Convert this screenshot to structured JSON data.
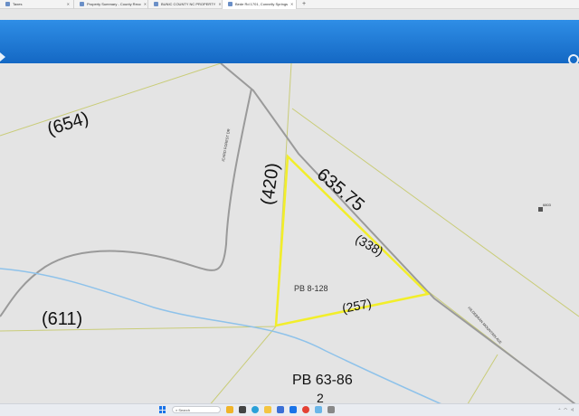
{
  "browser": {
    "tabs": [
      {
        "label": "Taxes",
        "active": false
      },
      {
        "label": "Property Summary - County Recc",
        "active": false
      },
      {
        "label": "BUNIC COUNTY NC PROPERTY",
        "active": false
      },
      {
        "label": "Bede Rd 1701, Connelly Springs",
        "active": true
      }
    ],
    "new_tab": "+"
  },
  "map": {
    "labels": {
      "parcel_654": "(654)",
      "parcel_420": "(420)",
      "parcel_611": "(611)",
      "road_635": "635.75",
      "seg_338": "(338)",
      "seg_257": "(257)",
      "pb_small": "PB 8-128",
      "pb_big": "PB 63-86",
      "lot_2": "2",
      "road_forest": "ICARD FOREST DR",
      "road_hildebrand": "HILDEBRAN MOUNTAIN AVE",
      "marker_code": "6803"
    },
    "colors": {
      "road": "#9a9a9a",
      "parcel_line": "#c9cc78",
      "highlight": "#f2ee2a",
      "stream": "#8ec2ea"
    }
  },
  "taskbar": {
    "search_placeholder": "Search",
    "icons": [
      "windows-start-icon",
      "search-icon",
      "weather-icon",
      "task-view-icon",
      "edge-browser-icon",
      "file-explorer-icon",
      "store-icon",
      "mail-icon",
      "chrome-icon",
      "photos-icon",
      "settings-icon"
    ]
  }
}
